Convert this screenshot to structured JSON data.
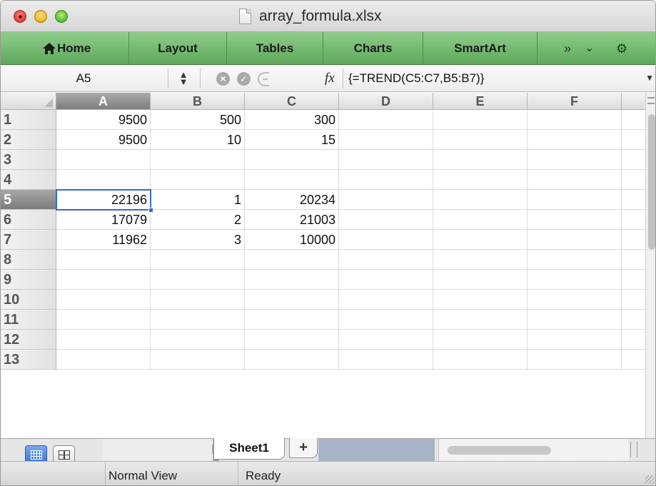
{
  "window": {
    "title": "array_formula.xlsx"
  },
  "ribbon": {
    "tabs": [
      "Home",
      "Layout",
      "Tables",
      "Charts",
      "SmartArt"
    ],
    "overflow_icon": "»",
    "dropdown_icon": "⌄",
    "settings_icon": "⚙"
  },
  "formula_bar": {
    "name_box": "A5",
    "fx_label": "fx",
    "formula": "{=TREND(C5:C7,B5:B7)}"
  },
  "grid": {
    "columns": [
      "A",
      "B",
      "C",
      "D",
      "E",
      "F"
    ],
    "selected_column": "A",
    "selected_row": 5,
    "row_numbers": [
      "1",
      "2",
      "3",
      "4",
      "5",
      "6",
      "7",
      "8",
      "9",
      "10",
      "11",
      "12",
      "13"
    ],
    "rows": [
      [
        "9500",
        "500",
        "300",
        "",
        "",
        ""
      ],
      [
        "9500",
        "10",
        "15",
        "",
        "",
        ""
      ],
      [
        "",
        "",
        "",
        "",
        "",
        ""
      ],
      [
        "",
        "",
        "",
        "",
        "",
        ""
      ],
      [
        "22196",
        "1",
        "20234",
        "",
        "",
        ""
      ],
      [
        "17079",
        "2",
        "21003",
        "",
        "",
        ""
      ],
      [
        "11962",
        "3",
        "10000",
        "",
        "",
        ""
      ],
      [
        "",
        "",
        "",
        "",
        "",
        ""
      ],
      [
        "",
        "",
        "",
        "",
        "",
        ""
      ],
      [
        "",
        "",
        "",
        "",
        "",
        ""
      ],
      [
        "",
        "",
        "",
        "",
        "",
        ""
      ],
      [
        "",
        "",
        "",
        "",
        "",
        ""
      ],
      [
        "",
        "",
        "",
        "",
        "",
        ""
      ]
    ]
  },
  "sheets": {
    "tabs": [
      "Sheet1"
    ],
    "active": "Sheet1",
    "add_label": "+"
  },
  "status": {
    "view": "Normal View",
    "state": "Ready"
  },
  "colors": {
    "ribbon_green": "#6fb56b",
    "selection_blue": "#3a67d6"
  }
}
